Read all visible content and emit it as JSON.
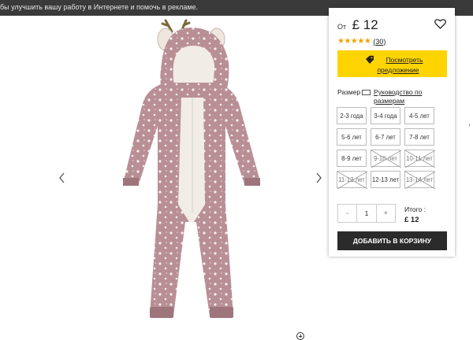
{
  "cookie_banner": {
    "text": "бы улучшить вашу работу в Интернете и помочь в рекламе."
  },
  "product": {
    "price_prefix": "От",
    "price": "£ 12",
    "rating_stars": 5,
    "review_count": "(30)",
    "promo_line1": "Посмотреть",
    "promo_line2": "предложение",
    "size_label": "Размер",
    "size_guide_line1": "Руководство по",
    "size_guide_line2": "размерам",
    "sizes": [
      {
        "label": "2-3 года",
        "available": true
      },
      {
        "label": "3-4 года",
        "available": true
      },
      {
        "label": "4-5 лет",
        "available": true
      },
      {
        "label": "5-6 лет",
        "available": true
      },
      {
        "label": "6-7 лет",
        "available": true
      },
      {
        "label": "7-8 лет",
        "available": true
      },
      {
        "label": "8-9 лет",
        "available": true
      },
      {
        "label": "9-10 лет",
        "available": false
      },
      {
        "label": "10-11 лет",
        "available": false
      },
      {
        "label": "11-12 лет",
        "available": false
      },
      {
        "label": "12-13 лет",
        "available": true
      },
      {
        "label": "13-14 лет",
        "available": false
      }
    ],
    "quantity_minus": "-",
    "quantity": "1",
    "quantity_plus": "+",
    "total_label": "Итого :",
    "total_value": "£ 12",
    "add_to_cart": "ДОБАВИТЬ В КОРЗИНУ"
  },
  "colors": {
    "onesie": "#b98f96",
    "onesie_dark": "#9f757c",
    "fleece": "#f1ece6",
    "promo": "#ffd400",
    "star": "#f0a500",
    "cart_button": "#2b2b2b"
  },
  "icons": {
    "gallery_prev": "chevron-left-icon",
    "gallery_next": "chevron-right-icon",
    "wishlist": "heart-icon",
    "promo": "tag-icon",
    "zoom": "zoom-in-icon"
  }
}
